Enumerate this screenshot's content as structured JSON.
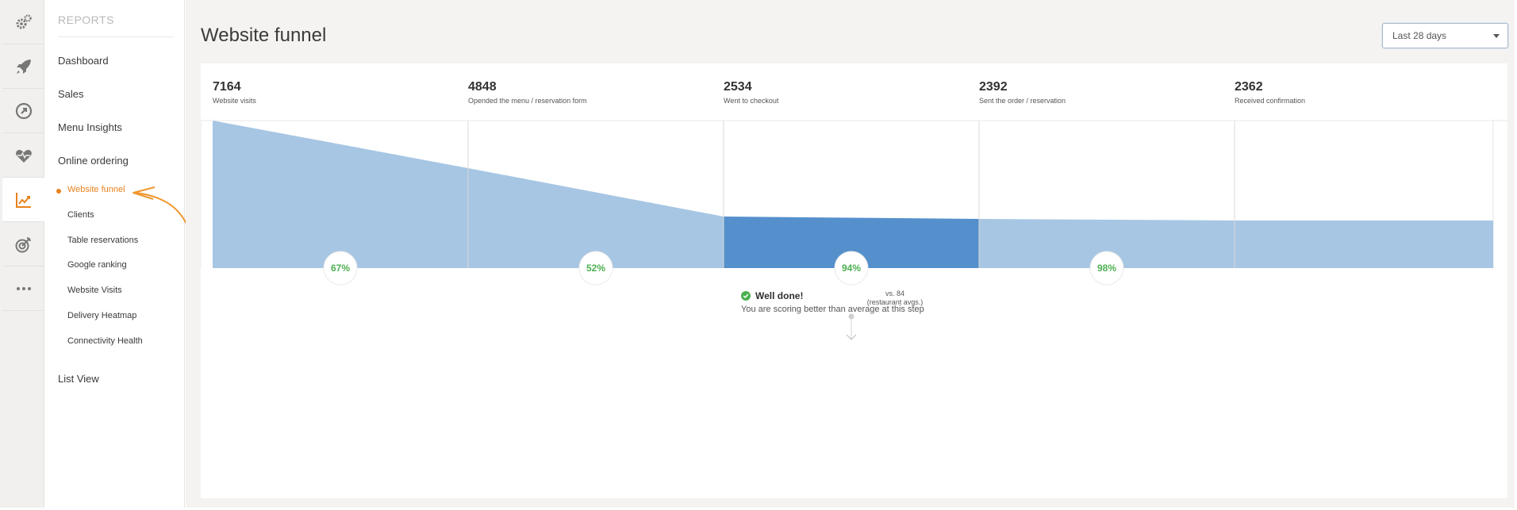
{
  "rail": {
    "icons": [
      "gears-icon",
      "rocket-icon",
      "external-link-circle-icon",
      "heart-pulse-icon",
      "line-chart-icon",
      "target-icon",
      "more-dots-icon"
    ],
    "active_index": 4,
    "accent": "#e8821c"
  },
  "nav": {
    "heading": "REPORTS",
    "items": [
      {
        "label": "Dashboard"
      },
      {
        "label": "Sales"
      },
      {
        "label": "Menu Insights"
      },
      {
        "label": "Online ordering"
      }
    ],
    "sub_items": [
      {
        "label": "Website funnel",
        "active": true
      },
      {
        "label": "Clients"
      },
      {
        "label": "Table reservations"
      },
      {
        "label": "Google ranking"
      },
      {
        "label": "Website Visits"
      },
      {
        "label": "Delivery Heatmap"
      },
      {
        "label": "Connectivity Health"
      }
    ],
    "list_view": "List View"
  },
  "header": {
    "title": "Website funnel",
    "date_range": "Last 28 days"
  },
  "funnel": {
    "stages": [
      {
        "value": "7164",
        "label": "Website visits"
      },
      {
        "value": "4848",
        "label": "Opended the menu / reservation form"
      },
      {
        "value": "2534",
        "label": "Went to checkout"
      },
      {
        "value": "2392",
        "label": "Sent the order / reservation"
      },
      {
        "value": "2362",
        "label": "Received confirmation"
      }
    ],
    "conversions": [
      "67%",
      "52%",
      "94%",
      "98%"
    ],
    "highlight_step": 2,
    "comparison": {
      "line1": "vs. 84",
      "line2": "(restaurant avgs.)"
    },
    "feedback": {
      "title": "Well done!",
      "message": "You are scoring better than average at this step"
    },
    "colors": {
      "light": "#a7c6e3",
      "dark": "#5590cd",
      "positive": "#4cb050"
    }
  }
}
